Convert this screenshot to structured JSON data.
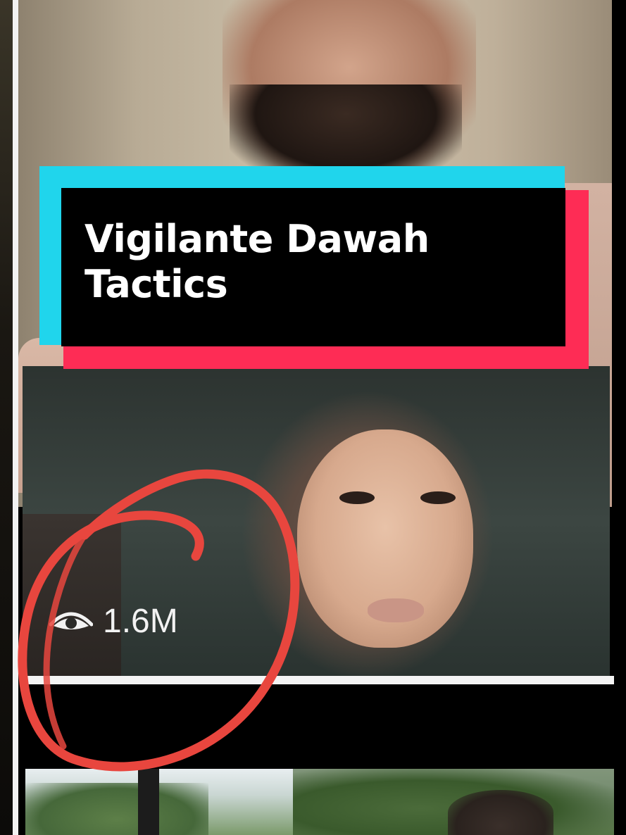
{
  "post": {
    "title_line1": "Vigilante Dawah",
    "title_line2": "Tactics"
  },
  "clip": {
    "view_count": "1.6M",
    "view_icon": "eye-icon"
  },
  "colors": {
    "title_card_cyan": "#20d5ec",
    "title_card_pink": "#fe2c55",
    "title_card_bg": "#000000",
    "annotation_red": "#e8463e"
  }
}
